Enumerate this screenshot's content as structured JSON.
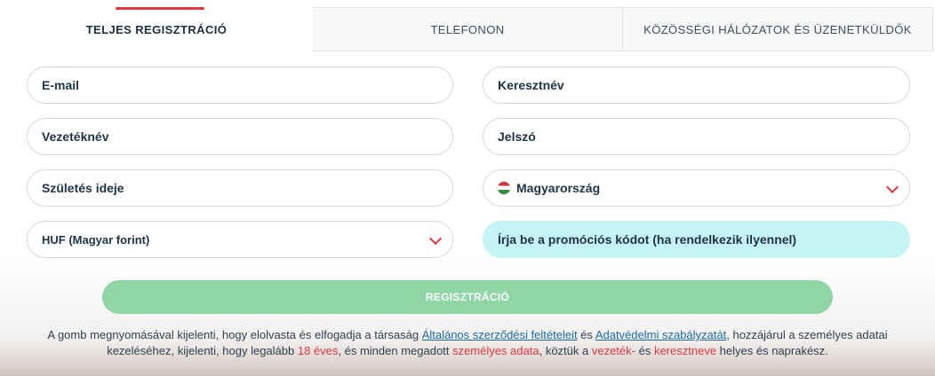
{
  "tabs": [
    {
      "label": "TELJES REGISZTRÁCIÓ",
      "active": true
    },
    {
      "label": "TELEFONON",
      "active": false
    },
    {
      "label": "KÖZÖSSÉGI HÁLÓZATOK ÉS ÜZENETKÜLDŐK",
      "active": false
    }
  ],
  "form": {
    "email": "E-mail",
    "first_name": "Keresztnév",
    "last_name": "Vezetéknév",
    "password": "Jelszó",
    "birth_date": "Születés ideje",
    "country": "Magyarország",
    "currency": "HUF (Magyar forint)",
    "promo_code": "Írja be a promóciós kódot (ha rendelkezik ilyennel)"
  },
  "register_button": "REGISZTRÁCIÓ",
  "legal": {
    "part1": "A gomb megnyomásával kijelenti, hogy elolvasta és elfogadja a társaság ",
    "terms_link": "Általános szerződési feltételeit",
    "part2": " és ",
    "privacy_link": "Adatvédelmi szabályzatát",
    "part3": ", hozzájárul a személyes adatai",
    "part4": "kezeléséhez, kijelenti, hogy legalább ",
    "age": "18 éves",
    "part5": ", és minden megadott ",
    "personal_data": "személyes adata",
    "part6": ", köztük a ",
    "surname": "vezeték-",
    "part7": " és ",
    "given_name": "keresztneve",
    "part8": " helyes és naprakész."
  },
  "colors": {
    "accent_red": "#e1373d",
    "button_green": "#8fd5a6",
    "promo_bg": "#c6f3f6",
    "link_blue": "#1a6aa6"
  }
}
